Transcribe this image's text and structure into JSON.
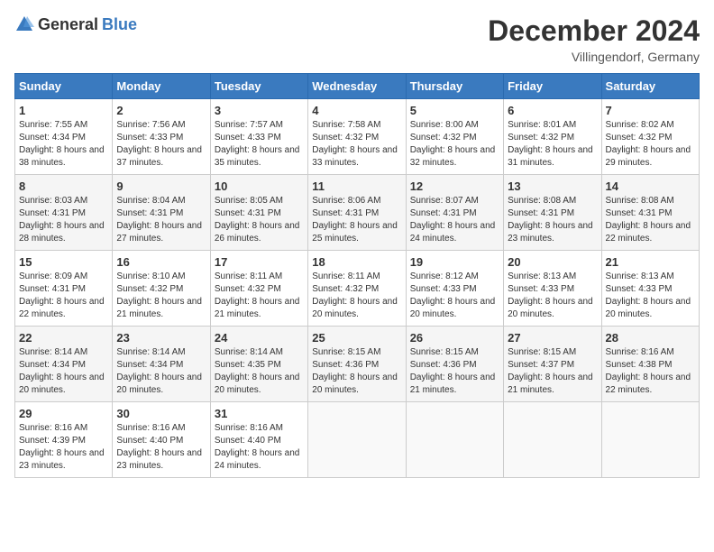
{
  "header": {
    "logo_general": "General",
    "logo_blue": "Blue",
    "month_year": "December 2024",
    "location": "Villingendorf, Germany"
  },
  "weekdays": [
    "Sunday",
    "Monday",
    "Tuesday",
    "Wednesday",
    "Thursday",
    "Friday",
    "Saturday"
  ],
  "weeks": [
    [
      {
        "day": "1",
        "sunrise": "7:55 AM",
        "sunset": "4:34 PM",
        "daylight": "8 hours and 38 minutes."
      },
      {
        "day": "2",
        "sunrise": "7:56 AM",
        "sunset": "4:33 PM",
        "daylight": "8 hours and 37 minutes."
      },
      {
        "day": "3",
        "sunrise": "7:57 AM",
        "sunset": "4:33 PM",
        "daylight": "8 hours and 35 minutes."
      },
      {
        "day": "4",
        "sunrise": "7:58 AM",
        "sunset": "4:32 PM",
        "daylight": "8 hours and 33 minutes."
      },
      {
        "day": "5",
        "sunrise": "8:00 AM",
        "sunset": "4:32 PM",
        "daylight": "8 hours and 32 minutes."
      },
      {
        "day": "6",
        "sunrise": "8:01 AM",
        "sunset": "4:32 PM",
        "daylight": "8 hours and 31 minutes."
      },
      {
        "day": "7",
        "sunrise": "8:02 AM",
        "sunset": "4:32 PM",
        "daylight": "8 hours and 29 minutes."
      }
    ],
    [
      {
        "day": "8",
        "sunrise": "8:03 AM",
        "sunset": "4:31 PM",
        "daylight": "8 hours and 28 minutes."
      },
      {
        "day": "9",
        "sunrise": "8:04 AM",
        "sunset": "4:31 PM",
        "daylight": "8 hours and 27 minutes."
      },
      {
        "day": "10",
        "sunrise": "8:05 AM",
        "sunset": "4:31 PM",
        "daylight": "8 hours and 26 minutes."
      },
      {
        "day": "11",
        "sunrise": "8:06 AM",
        "sunset": "4:31 PM",
        "daylight": "8 hours and 25 minutes."
      },
      {
        "day": "12",
        "sunrise": "8:07 AM",
        "sunset": "4:31 PM",
        "daylight": "8 hours and 24 minutes."
      },
      {
        "day": "13",
        "sunrise": "8:08 AM",
        "sunset": "4:31 PM",
        "daylight": "8 hours and 23 minutes."
      },
      {
        "day": "14",
        "sunrise": "8:08 AM",
        "sunset": "4:31 PM",
        "daylight": "8 hours and 22 minutes."
      }
    ],
    [
      {
        "day": "15",
        "sunrise": "8:09 AM",
        "sunset": "4:31 PM",
        "daylight": "8 hours and 22 minutes."
      },
      {
        "day": "16",
        "sunrise": "8:10 AM",
        "sunset": "4:32 PM",
        "daylight": "8 hours and 21 minutes."
      },
      {
        "day": "17",
        "sunrise": "8:11 AM",
        "sunset": "4:32 PM",
        "daylight": "8 hours and 21 minutes."
      },
      {
        "day": "18",
        "sunrise": "8:11 AM",
        "sunset": "4:32 PM",
        "daylight": "8 hours and 20 minutes."
      },
      {
        "day": "19",
        "sunrise": "8:12 AM",
        "sunset": "4:33 PM",
        "daylight": "8 hours and 20 minutes."
      },
      {
        "day": "20",
        "sunrise": "8:13 AM",
        "sunset": "4:33 PM",
        "daylight": "8 hours and 20 minutes."
      },
      {
        "day": "21",
        "sunrise": "8:13 AM",
        "sunset": "4:33 PM",
        "daylight": "8 hours and 20 minutes."
      }
    ],
    [
      {
        "day": "22",
        "sunrise": "8:14 AM",
        "sunset": "4:34 PM",
        "daylight": "8 hours and 20 minutes."
      },
      {
        "day": "23",
        "sunrise": "8:14 AM",
        "sunset": "4:34 PM",
        "daylight": "8 hours and 20 minutes."
      },
      {
        "day": "24",
        "sunrise": "8:14 AM",
        "sunset": "4:35 PM",
        "daylight": "8 hours and 20 minutes."
      },
      {
        "day": "25",
        "sunrise": "8:15 AM",
        "sunset": "4:36 PM",
        "daylight": "8 hours and 20 minutes."
      },
      {
        "day": "26",
        "sunrise": "8:15 AM",
        "sunset": "4:36 PM",
        "daylight": "8 hours and 21 minutes."
      },
      {
        "day": "27",
        "sunrise": "8:15 AM",
        "sunset": "4:37 PM",
        "daylight": "8 hours and 21 minutes."
      },
      {
        "day": "28",
        "sunrise": "8:16 AM",
        "sunset": "4:38 PM",
        "daylight": "8 hours and 22 minutes."
      }
    ],
    [
      {
        "day": "29",
        "sunrise": "8:16 AM",
        "sunset": "4:39 PM",
        "daylight": "8 hours and 23 minutes."
      },
      {
        "day": "30",
        "sunrise": "8:16 AM",
        "sunset": "4:40 PM",
        "daylight": "8 hours and 23 minutes."
      },
      {
        "day": "31",
        "sunrise": "8:16 AM",
        "sunset": "4:40 PM",
        "daylight": "8 hours and 24 minutes."
      },
      null,
      null,
      null,
      null
    ]
  ]
}
